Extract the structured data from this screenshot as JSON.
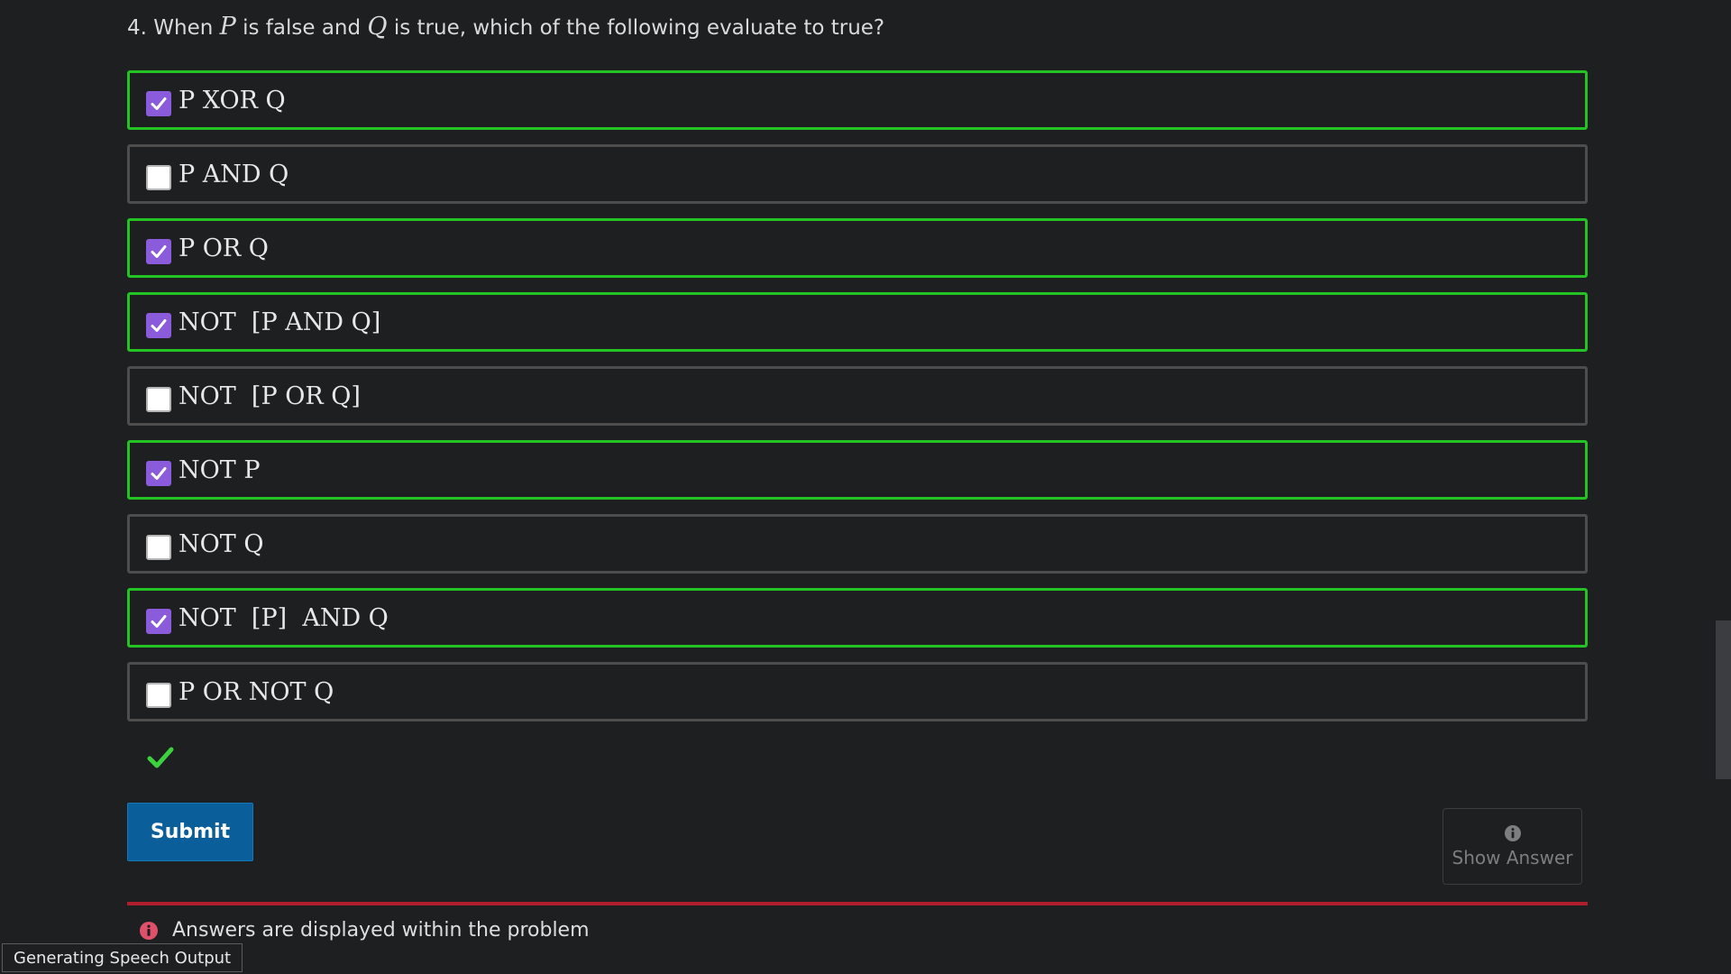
{
  "question": {
    "prefix": "4. When ",
    "var_p": "P",
    "middle": " is false and ",
    "var_q": "Q",
    "suffix": " is true, which of the following evaluate to true?"
  },
  "options": [
    {
      "label": "P XOR Q",
      "checked": true
    },
    {
      "label": "P AND Q",
      "checked": false
    },
    {
      "label": "P OR Q",
      "checked": true
    },
    {
      "label": "NOT  [P AND Q]",
      "checked": true
    },
    {
      "label": "NOT  [P OR Q]",
      "checked": false
    },
    {
      "label": "NOT P",
      "checked": true
    },
    {
      "label": "NOT Q",
      "checked": false
    },
    {
      "label": "NOT  [P]  AND Q",
      "checked": true
    },
    {
      "label": "P OR NOT Q",
      "checked": false
    }
  ],
  "feedback": {
    "icon": "checkmark-icon",
    "color": "#3ed13e"
  },
  "submit": {
    "label": "Submit"
  },
  "show_answer": {
    "icon": "info-icon",
    "label": "Show Answer"
  },
  "notice": {
    "icon": "info-icon",
    "text": "Answers are displayed within the problem",
    "icon_color": "#e0506a"
  },
  "status": {
    "text": "Generating Speech Output"
  },
  "colors": {
    "correct_border": "#22c322",
    "checkbox_checked": "#8a5cdb",
    "submit_bg": "#0a5f9a",
    "divider": "#b01e2e"
  }
}
